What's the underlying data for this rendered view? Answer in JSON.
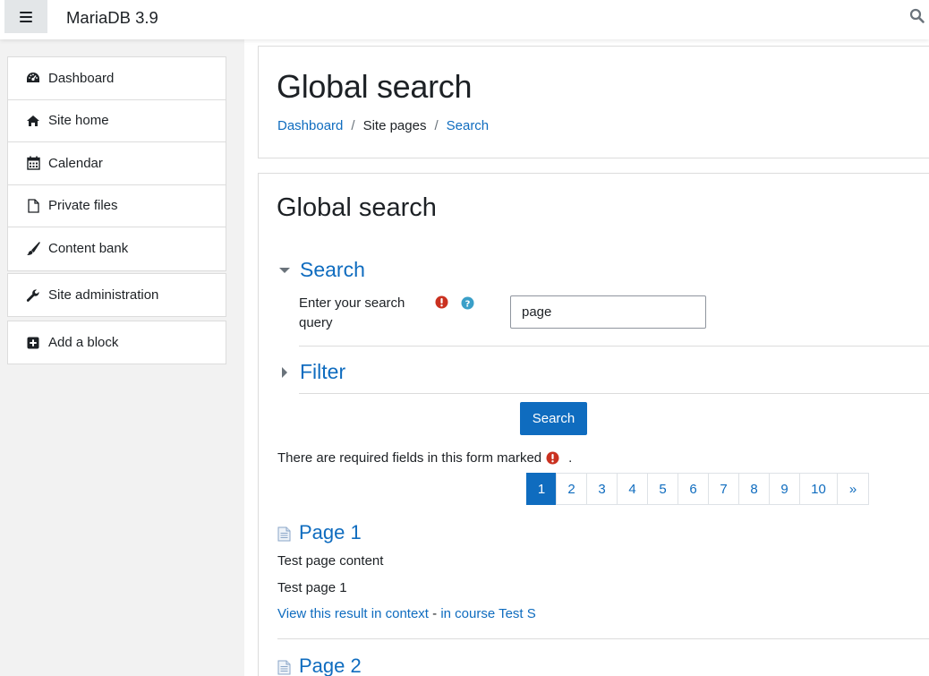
{
  "navbar": {
    "site_name": "MariaDB 3.9"
  },
  "drawer": {
    "primary": [
      {
        "label": "Dashboard",
        "icon": "dashboard-icon"
      },
      {
        "label": "Site home",
        "icon": "home-icon"
      },
      {
        "label": "Calendar",
        "icon": "calendar-icon"
      },
      {
        "label": "Private files",
        "icon": "file-icon"
      },
      {
        "label": "Content bank",
        "icon": "paintbrush-icon"
      }
    ],
    "admin": {
      "label": "Site administration",
      "icon": "wrench-icon"
    },
    "add_block": {
      "label": "Add a block",
      "icon": "plus-square-icon"
    }
  },
  "header": {
    "title": "Global search",
    "breadcrumb": [
      "Dashboard",
      "Site pages",
      "Search"
    ],
    "separator": "/"
  },
  "main": {
    "title": "Global search",
    "search_section": {
      "legend": "Search",
      "field_label": "Enter your search query",
      "query_value": "page"
    },
    "filter_section": {
      "legend": "Filter"
    },
    "submit_label": "Search",
    "required_note": "There are required fields in this form marked",
    "required_note_end": ".",
    "pagination": [
      "1",
      "2",
      "3",
      "4",
      "5",
      "6",
      "7",
      "8",
      "9",
      "10",
      "»"
    ],
    "pagination_active": "1",
    "results": [
      {
        "title": "Page 1",
        "content": "Test page content",
        "description": "Test page 1",
        "context_link": "View this result in context",
        "dash": "-",
        "course_link": "in course Test S"
      },
      {
        "title": "Page 2"
      }
    ]
  },
  "colors": {
    "link": "#0f6cbf",
    "required": "#ca3120",
    "help": "#1f7e9a",
    "drawer_bg": "#f2f2f2"
  }
}
